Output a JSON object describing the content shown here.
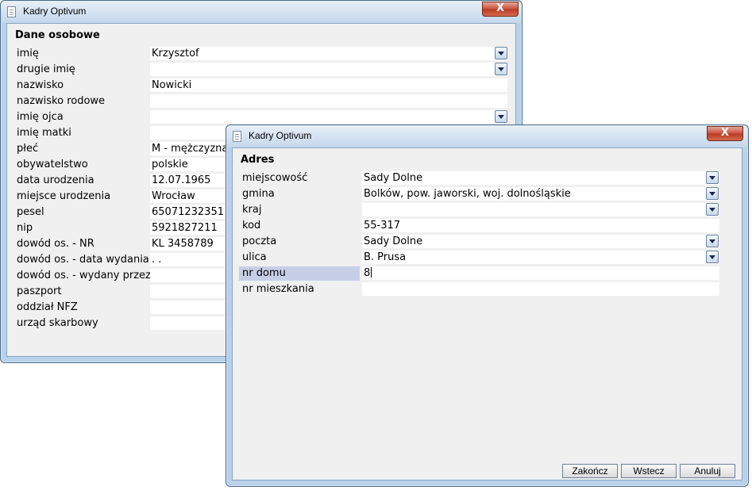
{
  "window1": {
    "title": "Kadry Optivum",
    "close_label": "X",
    "section": "Dane osobowe",
    "fields": [
      {
        "label": "imię",
        "value": "Krzysztof"
      },
      {
        "label": "drugie imię",
        "value": ""
      },
      {
        "label": "nazwisko",
        "value": "Nowicki"
      },
      {
        "label": "nazwisko rodowe",
        "value": ""
      },
      {
        "label": "imię ojca",
        "value": ""
      },
      {
        "label": "imię matki",
        "value": ""
      },
      {
        "label": "płeć",
        "value": "M - mężczyzna"
      },
      {
        "label": "obywatelstwo",
        "value": "polskie"
      },
      {
        "label": "data urodzenia",
        "value": "12.07.1965"
      },
      {
        "label": "miejsce urodzenia",
        "value": "Wrocław"
      },
      {
        "label": "pesel",
        "value": "65071232351"
      },
      {
        "label": "nip",
        "value": "5921827211"
      },
      {
        "label": "dowód os. - NR",
        "value": "KL 3458789"
      },
      {
        "label": "dowód os. - data wydania",
        "value": " . ."
      },
      {
        "label": "dowód os. - wydany przez",
        "value": ""
      },
      {
        "label": "paszport",
        "value": ""
      },
      {
        "label": "oddział NFZ",
        "value": ""
      },
      {
        "label": "urząd skarbowy",
        "value": ""
      }
    ]
  },
  "window2": {
    "title": "Kadry Optivum",
    "close_label": "X",
    "section": "Adres",
    "fields": [
      {
        "label": "miejscowość",
        "value": "Sady Dolne"
      },
      {
        "label": "gmina",
        "value": "Bolków, pow. jaworski, woj. dolnośląskie"
      },
      {
        "label": "kraj",
        "value": ""
      },
      {
        "label": "kod",
        "value": "55-317"
      },
      {
        "label": "poczta",
        "value": "Sady Dolne"
      },
      {
        "label": "ulica",
        "value": "B. Prusa"
      },
      {
        "label": "nr domu",
        "value": "8"
      },
      {
        "label": "nr mieszkania",
        "value": ""
      }
    ],
    "buttons": {
      "finish": "Zakończ",
      "back": "Wstecz",
      "cancel": "Anuluj"
    }
  }
}
